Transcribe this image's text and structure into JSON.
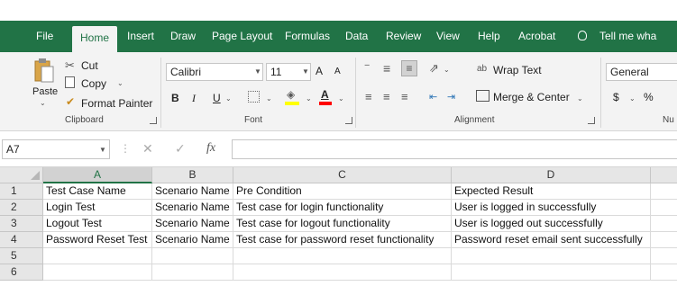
{
  "menu": {
    "tabs": [
      "File",
      "Home",
      "Insert",
      "Draw",
      "Page Layout",
      "Formulas",
      "Data",
      "Review",
      "View",
      "Help",
      "Acrobat"
    ],
    "active": "Home",
    "tell_me": "Tell me wha",
    "brand_color": "#217346"
  },
  "ribbon": {
    "clipboard": {
      "paste": "Paste",
      "cut": "Cut",
      "copy": "Copy",
      "format_painter": "Format Painter",
      "group": "Clipboard"
    },
    "font": {
      "name": "Calibri",
      "size": "11",
      "bold": "B",
      "italic": "I",
      "underline": "U",
      "grow": "A",
      "shrink": "A",
      "font_color_letter": "A",
      "group": "Font",
      "highlight_color": "#ffff00",
      "font_color": "#ff0000"
    },
    "alignment": {
      "wrap_text": "Wrap Text",
      "merge_center": "Merge & Center",
      "group": "Alignment"
    },
    "number": {
      "format": "General",
      "currency": "$",
      "percent": "%",
      "group": "Nu"
    }
  },
  "formula_bar": {
    "name_box": "A7",
    "fx": "fx",
    "value": ""
  },
  "sheet": {
    "columns": [
      "A",
      "B",
      "C",
      "D"
    ],
    "rows": [
      "1",
      "2",
      "3",
      "4",
      "5",
      "6"
    ],
    "selected_cell": "A7",
    "cells": [
      [
        "Test Case Name",
        "Scenario Name",
        "Pre Condition",
        "Expected Result"
      ],
      [
        "Login Test",
        "Scenario Name",
        "Test case for login functionality",
        "User is logged in successfully"
      ],
      [
        "Logout Test",
        "Scenario Name",
        "Test case for logout functionality",
        "User is logged out successfully"
      ],
      [
        "Password Reset Test",
        "Scenario Name",
        "Test case for password reset functionality",
        "Password reset email sent successfully"
      ],
      [
        "",
        "",
        "",
        ""
      ],
      [
        "",
        "",
        "",
        ""
      ]
    ]
  }
}
